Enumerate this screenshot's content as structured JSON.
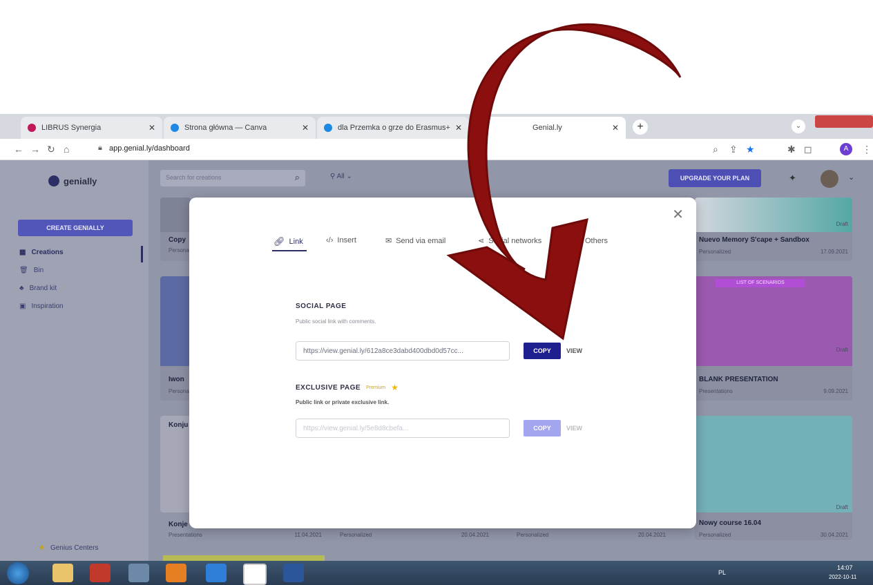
{
  "browser": {
    "tabs": [
      {
        "title": "LIBRUS Synergia"
      },
      {
        "title": "Strona główna — Canva"
      },
      {
        "title": "dla Przemka o grze do Erasmus+"
      },
      {
        "title": "Genial.ly"
      }
    ],
    "url": "app.genial.ly/dashboard",
    "profile_initial": "A"
  },
  "app": {
    "logo_text": "genially",
    "search_placeholder": "Search for creations",
    "filter_label": "All",
    "upgrade_label": "UPGRADE YOUR PLAN",
    "create_label": "CREATE GENIALLY",
    "nav": [
      {
        "label": "Creations"
      },
      {
        "label": "Bin"
      },
      {
        "label": "Brand kit"
      },
      {
        "label": "Inspiration"
      }
    ],
    "genius_label": "Genius Centers",
    "cards": [
      {
        "title": "Copy",
        "sub": "Personalized",
        "date": ""
      },
      {
        "title": "Nuevo Memory S'cape + Sandbox",
        "sub": "Personalized",
        "date": "17.09.2021",
        "status": "Draft"
      },
      {
        "title": "Iwon",
        "sub": "Personalized",
        "date": ""
      },
      {
        "title": "BLANK PRESENTATION",
        "sub": "Presentations",
        "date": "9.09.2021",
        "status": "Draft",
        "banner": "LIST OF SCENARIOS"
      },
      {
        "title": "Konju",
        "sub": "",
        "date": ""
      },
      {
        "title": "Nowy course 16.04",
        "sub": "Personalized",
        "date": "30.04.2021",
        "status": "Draft"
      },
      {
        "title": "Konje",
        "sub": "Presentations",
        "date": "11.04.2021"
      },
      {
        "title": "",
        "sub": "Personalized",
        "date": "20.04.2021"
      },
      {
        "title": "",
        "sub": "Personalized",
        "date": "20.04.2021"
      }
    ]
  },
  "modal": {
    "tabs": [
      {
        "label": "Link"
      },
      {
        "label": "Insert"
      },
      {
        "label": "Send via email"
      },
      {
        "label": "Social networks"
      },
      {
        "label": "Others"
      }
    ],
    "social": {
      "title": "SOCIAL PAGE",
      "desc": "Public social link with comments.",
      "url": "https://view.genial.ly/612a8ce3dabd400dbd0d57cc...",
      "copy": "COPY",
      "view": "VIEW"
    },
    "exclusive": {
      "title": "EXCLUSIVE PAGE",
      "badge": "Premium",
      "desc": "Public link or private exclusive link.",
      "url": "https://view.genial.ly/5e8d8cbefa...",
      "copy": "COPY",
      "view": "VIEW"
    }
  },
  "taskbar": {
    "lang": "PL",
    "time": "14:07",
    "date": "2022-10-11"
  },
  "colors": {
    "arrow": "#8b0f0f",
    "primary": "#1f1f8f",
    "overlay": "#9196a8"
  }
}
